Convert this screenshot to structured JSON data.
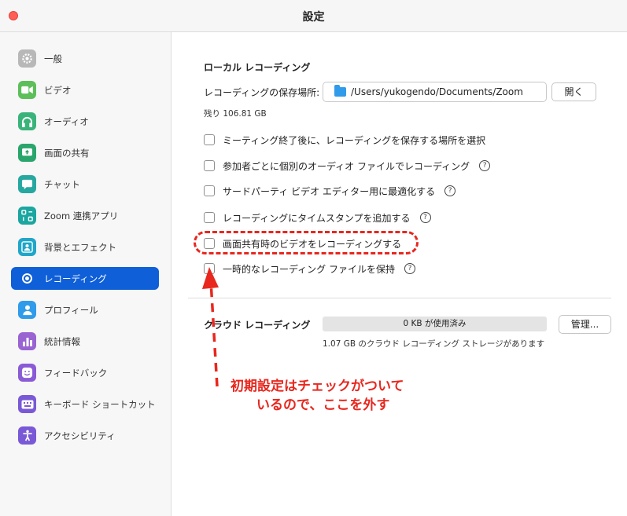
{
  "window": {
    "title": "設定"
  },
  "sidebar": {
    "items": [
      {
        "label": "一般",
        "icon": "gear-icon",
        "color": "#b8b8b8"
      },
      {
        "label": "ビデオ",
        "icon": "video-camera-icon",
        "color": "#5cbf5a"
      },
      {
        "label": "オーディオ",
        "icon": "headphones-icon",
        "color": "#39b37a"
      },
      {
        "label": "画面の共有",
        "icon": "screen-share-icon",
        "color": "#2aa56b"
      },
      {
        "label": "チャット",
        "icon": "chat-bubble-icon",
        "color": "#26a8a0"
      },
      {
        "label": "Zoom 連携アプリ",
        "icon": "apps-icon",
        "color": "#1ba6a0"
      },
      {
        "label": "背景とエフェクト",
        "icon": "person-background-icon",
        "color": "#20a6c9"
      },
      {
        "label": "レコーディング",
        "icon": "record-icon",
        "color": "#0e5fd8",
        "active": true
      },
      {
        "label": "プロフィール",
        "icon": "profile-icon",
        "color": "#2f9bea"
      },
      {
        "label": "統計情報",
        "icon": "statistics-icon",
        "color": "#9a63d2"
      },
      {
        "label": "フィードバック",
        "icon": "feedback-smile-icon",
        "color": "#8a5bd6"
      },
      {
        "label": "キーボード ショートカット",
        "icon": "keyboard-icon",
        "color": "#7a59d6"
      },
      {
        "label": "アクセシビリティ",
        "icon": "accessibility-icon",
        "color": "#7a59d6"
      }
    ]
  },
  "local_recording": {
    "title": "ローカル レコーディング",
    "save_location_label": "レコーディングの保存場所:",
    "path": "/Users/yukogendo/Documents/Zoom",
    "open_button": "開く",
    "free_space": "残り 106.81 GB",
    "options": [
      {
        "label": "ミーティング終了後に、レコーディングを保存する場所を選択",
        "checked": false,
        "help": false
      },
      {
        "label": "参加者ごとに個別のオーディオ ファイルでレコーディング",
        "checked": false,
        "help": true
      },
      {
        "label": "サードパーティ ビデオ エディター用に最適化する",
        "checked": false,
        "help": true
      },
      {
        "label": "レコーディングにタイムスタンプを追加する",
        "checked": false,
        "help": true
      },
      {
        "label": "画面共有時のビデオをレコーディングする",
        "checked": false,
        "help": false
      },
      {
        "label": "一時的なレコーディング ファイルを保持",
        "checked": false,
        "help": true
      }
    ]
  },
  "cloud_recording": {
    "title": "クラウド レコーディング",
    "usage": "0 KB が使用済み",
    "manage_button": "管理...",
    "storage_note": "1.07 GB のクラウド レコーディング ストレージがあります"
  },
  "annotation": {
    "line1": "初期設定はチェックがついて",
    "line2": "いるので、ここを外す",
    "color": "#e8271e"
  },
  "help_glyph": "?"
}
